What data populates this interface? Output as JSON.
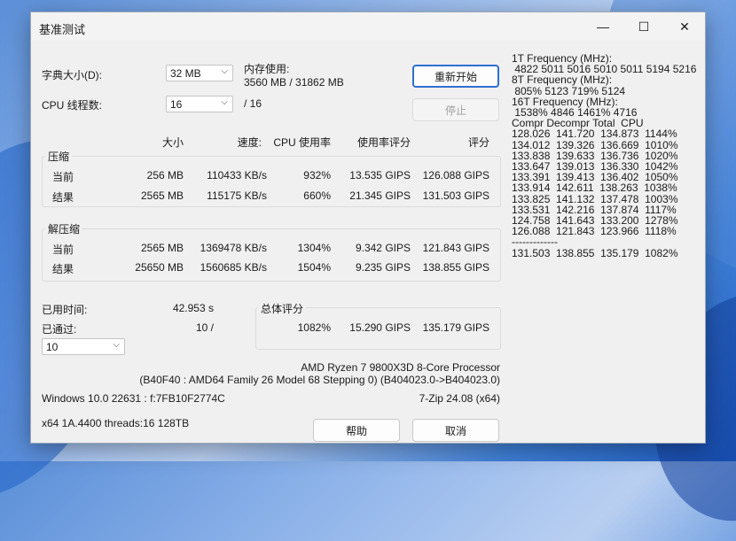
{
  "window": {
    "title": "基准测试",
    "min_glyph": "—",
    "max_glyph": "☐",
    "close_glyph": "✕"
  },
  "settings": {
    "dict_label": "字典大小(D):",
    "dict_value": "32 MB",
    "threads_label": "CPU 线程数:",
    "threads_value": "16",
    "threads_total": "/ 16",
    "mem_label": "内存使用:",
    "mem_value": "3560 MB / 31862 MB"
  },
  "buttons": {
    "restart": "重新开始",
    "stop": "停止",
    "help": "帮助",
    "cancel": "取消"
  },
  "headers": {
    "size": "大小",
    "speed": "速度:",
    "cpu": "CPU 使用率",
    "rating_usage": "使用率评分",
    "rating": "评分"
  },
  "compress": {
    "label": "压缩",
    "current": {
      "label": "当前",
      "size": "256 MB",
      "speed": "110433 KB/s",
      "cpu": "932%",
      "usage": "13.535 GIPS",
      "rating": "126.088 GIPS"
    },
    "result": {
      "label": "结果",
      "size": "2565 MB",
      "speed": "115175 KB/s",
      "cpu": "660%",
      "usage": "21.345 GIPS",
      "rating": "131.503 GIPS"
    }
  },
  "decompress": {
    "label": "解压缩",
    "current": {
      "label": "当前",
      "size": "2565 MB",
      "speed": "1369478 KB/s",
      "cpu": "1304%",
      "usage": "9.342 GIPS",
      "rating": "121.843 GIPS"
    },
    "result": {
      "label": "结果",
      "size": "25650 MB",
      "speed": "1560685 KB/s",
      "cpu": "1504%",
      "usage": "9.235 GIPS",
      "rating": "138.855 GIPS"
    }
  },
  "elapsed": {
    "label": "已用时间:",
    "value": "42.953 s"
  },
  "passes": {
    "label": "已通过:",
    "value": "10 /",
    "select_value": "10"
  },
  "total": {
    "label": "总体评分",
    "cpu": "1082%",
    "usage": "15.290 GIPS",
    "rating": "135.179 GIPS"
  },
  "system": {
    "cpu_name": "AMD Ryzen 7 9800X3D 8-Core Processor",
    "cpu_detail": "(B40F40 : AMD64 Family 26 Model 68 Stepping 0) (B404023.0->B404023.0)",
    "os": "Windows 10.0 22631 :  f:7FB10F2774C",
    "version": "7-Zip 24.08 (x64)",
    "arch": "x64 1A.4400 threads:16 128TB"
  },
  "log_lines": [
    "1T Frequency (MHz):",
    " 4822 5011 5016 5010 5011 5194 5216",
    "8T Frequency (MHz):",
    " 805% 5123 719% 5124",
    "16T Frequency (MHz):",
    " 1538% 4846 1461% 4716",
    "Compr Decompr Total  CPU",
    "128.026  141.720  134.873  1144%",
    "134.012  139.326  136.669  1010%",
    "133.838  139.633  136.736  1020%",
    "133.647  139.013  136.330  1042%",
    "133.391  139.413  136.402  1050%",
    "133.914  142.611  138.263  1038%",
    "133.825  141.132  137.478  1003%",
    "133.531  142.216  137.874  1117%",
    "124.758  141.643  133.200  1278%",
    "126.088  121.843  123.966  1118%",
    "-------------",
    "131.503  138.855  135.179  1082%"
  ]
}
